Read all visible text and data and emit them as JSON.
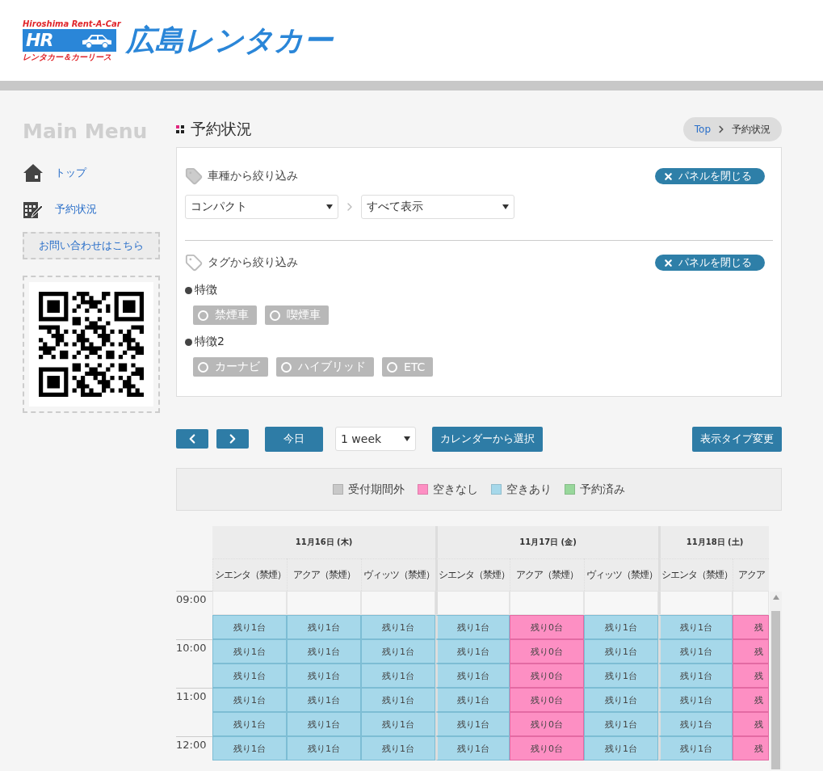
{
  "header": {
    "logo": {
      "tagline_top": "Hiroshima Rent-A-Car",
      "mark": "HR",
      "tagline_bottom": "レンタカー＆カーリース",
      "name": "広島レンタカー"
    }
  },
  "sidebar": {
    "title": "Main Menu",
    "items": [
      {
        "kind": "home",
        "label": "トップ"
      },
      {
        "kind": "calendar",
        "label": "予約状況"
      }
    ],
    "contact_button": "お問い合わせはこちら"
  },
  "page": {
    "title": "予約状況",
    "breadcrumb": [
      {
        "label": "Top",
        "kind": "link"
      },
      {
        "label": "予約状況",
        "kind": "current"
      }
    ]
  },
  "filters": [
    {
      "kind": "select",
      "title": "車種から絞り込み",
      "close_button": "パネルを閉じる",
      "selects": [
        "コンパクト",
        "すべて表示"
      ]
    },
    {
      "kind": "tags",
      "title": "タグから絞り込み",
      "close_button": "パネルを閉じる",
      "groups": [
        {
          "label": "特徴",
          "tags": [
            {
              "label": "禁煙車",
              "selected": false
            },
            {
              "label": "喫煙車",
              "selected": false
            }
          ]
        },
        {
          "label": "特徴2",
          "tags": [
            {
              "label": "カーナビ",
              "selected": false
            },
            {
              "label": "ハイブリッド",
              "selected": false
            },
            {
              "label": "ETC",
              "selected": false
            }
          ]
        }
      ]
    }
  ],
  "toolbar": {
    "today": "今日",
    "range": "1 week",
    "calendar_button": "カレンダーから選択",
    "view_button": "表示タイプ変更"
  },
  "legend": [
    {
      "label": "受付期間外",
      "color": "#c8c8c8"
    },
    {
      "label": "空きなし",
      "color": "#fd8fc3"
    },
    {
      "label": "空きあり",
      "color": "#a6d8ea"
    },
    {
      "label": "予約済み",
      "color": "#98d79b"
    }
  ],
  "schedule": {
    "days": [
      {
        "label": "11月16日 (木)",
        "columns": [
          "シエンタ（禁煙）",
          "アクア（禁煙）",
          "ヴィッツ（禁煙）"
        ]
      },
      {
        "label": "11月17日 (金)",
        "columns": [
          "シエンタ（禁煙）",
          "アクア（禁煙）",
          "ヴィッツ（禁煙）"
        ]
      },
      {
        "label": "11月18日 (土)",
        "columns": [
          "シエンタ（禁煙）",
          "アクア"
        ]
      }
    ],
    "slots": [
      {
        "time": "09:00",
        "cells": [
          {
            "kind": "blank"
          },
          {
            "kind": "blank"
          },
          {
            "kind": "blank"
          },
          {
            "kind": "blank"
          },
          {
            "kind": "blank"
          },
          {
            "kind": "blank"
          },
          {
            "kind": "blank"
          },
          {
            "kind": "blank"
          }
        ]
      },
      {
        "cells": [
          {
            "kind": "available",
            "text": "残り1台"
          },
          {
            "kind": "available",
            "text": "残り1台"
          },
          {
            "kind": "available",
            "text": "残り1台"
          },
          {
            "kind": "available",
            "text": "残り1台"
          },
          {
            "kind": "full",
            "text": "残り0台"
          },
          {
            "kind": "available",
            "text": "残り1台"
          },
          {
            "kind": "available",
            "text": "残り1台"
          },
          {
            "kind": "full",
            "text": "残"
          }
        ]
      },
      {
        "time": "10:00",
        "cells": [
          {
            "kind": "available",
            "text": "残り1台"
          },
          {
            "kind": "available",
            "text": "残り1台"
          },
          {
            "kind": "available",
            "text": "残り1台"
          },
          {
            "kind": "available",
            "text": "残り1台"
          },
          {
            "kind": "full",
            "text": "残り0台"
          },
          {
            "kind": "available",
            "text": "残り1台"
          },
          {
            "kind": "available",
            "text": "残り1台"
          },
          {
            "kind": "full",
            "text": "残"
          }
        ]
      },
      {
        "cells": [
          {
            "kind": "available",
            "text": "残り1台"
          },
          {
            "kind": "available",
            "text": "残り1台"
          },
          {
            "kind": "available",
            "text": "残り1台"
          },
          {
            "kind": "available",
            "text": "残り1台"
          },
          {
            "kind": "full",
            "text": "残り0台"
          },
          {
            "kind": "available",
            "text": "残り1台"
          },
          {
            "kind": "available",
            "text": "残り1台"
          },
          {
            "kind": "full",
            "text": "残"
          }
        ]
      },
      {
        "time": "11:00",
        "cells": [
          {
            "kind": "available",
            "text": "残り1台"
          },
          {
            "kind": "available",
            "text": "残り1台"
          },
          {
            "kind": "available",
            "text": "残り1台"
          },
          {
            "kind": "available",
            "text": "残り1台"
          },
          {
            "kind": "full",
            "text": "残り0台"
          },
          {
            "kind": "available",
            "text": "残り1台"
          },
          {
            "kind": "available",
            "text": "残り1台"
          },
          {
            "kind": "full",
            "text": "残"
          }
        ]
      },
      {
        "cells": [
          {
            "kind": "available",
            "text": "残り1台"
          },
          {
            "kind": "available",
            "text": "残り1台"
          },
          {
            "kind": "available",
            "text": "残り1台"
          },
          {
            "kind": "available",
            "text": "残り1台"
          },
          {
            "kind": "full",
            "text": "残り0台"
          },
          {
            "kind": "available",
            "text": "残り1台"
          },
          {
            "kind": "available",
            "text": "残り1台"
          },
          {
            "kind": "full",
            "text": "残"
          }
        ]
      },
      {
        "time": "12:00",
        "cells": [
          {
            "kind": "available",
            "text": "残り1台"
          },
          {
            "kind": "available",
            "text": "残り1台"
          },
          {
            "kind": "available",
            "text": "残り1台"
          },
          {
            "kind": "available",
            "text": "残り1台"
          },
          {
            "kind": "full",
            "text": "残り0台"
          },
          {
            "kind": "available",
            "text": "残り1台"
          },
          {
            "kind": "available",
            "text": "残り1台"
          },
          {
            "kind": "full",
            "text": "残"
          }
        ]
      }
    ]
  }
}
